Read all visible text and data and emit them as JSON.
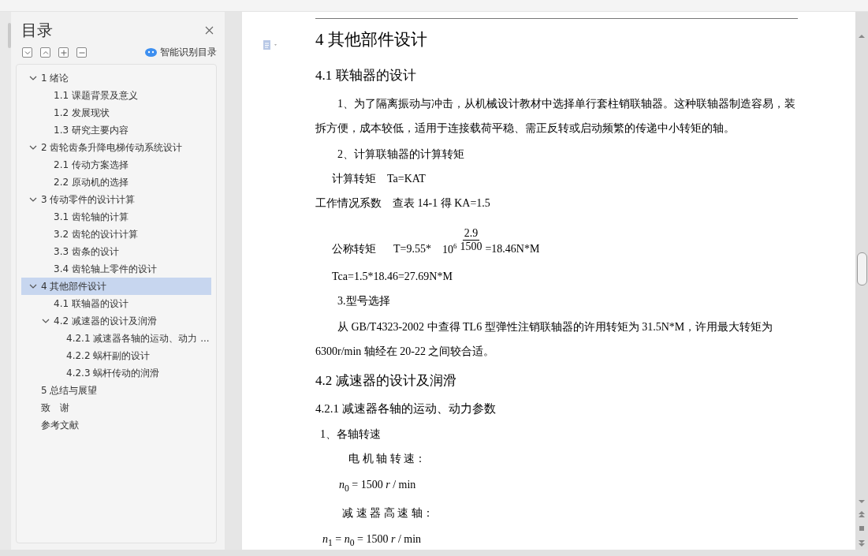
{
  "toc_panel": {
    "title": "目录",
    "smart_button": "智能识别目录",
    "items": [
      {
        "label": "1 绪论",
        "expanded": true,
        "selected": false,
        "children": [
          {
            "label": "1.1 课题背景及意义",
            "selected": false
          },
          {
            "label": "1.2 发展现状",
            "selected": false
          },
          {
            "label": "1.3 研究主要内容",
            "selected": false
          }
        ]
      },
      {
        "label": "2 齿轮齿条升降电梯传动系统设计",
        "expanded": true,
        "selected": false,
        "children": [
          {
            "label": "2.1 传动方案选择",
            "selected": false
          },
          {
            "label": "2.2 原动机的选择",
            "selected": false
          }
        ]
      },
      {
        "label": "3 传动零件的设计计算",
        "expanded": true,
        "selected": false,
        "children": [
          {
            "label": "3.1 齿轮轴的计算",
            "selected": false
          },
          {
            "label": "3.2 齿轮的设计计算",
            "selected": false
          },
          {
            "label": "3.3 齿条的设计",
            "selected": false
          },
          {
            "label": "3.4 齿轮轴上零件的设计",
            "selected": false
          }
        ]
      },
      {
        "label": "4 其他部件设计",
        "expanded": true,
        "selected": true,
        "children": [
          {
            "label": "4.1 联轴器的设计",
            "selected": false
          },
          {
            "label": "4.2 减速器的设计及润滑",
            "expanded": true,
            "selected": false,
            "children": [
              {
                "label": "4.2.1 减速器各轴的运动、动力 ...",
                "selected": false
              },
              {
                "label": "4.2.2 蜗杆副的设计",
                "selected": false
              },
              {
                "label": "4.2.3 蜗杆传动的润滑",
                "selected": false
              }
            ]
          }
        ]
      },
      {
        "label": "5 总结与展望",
        "selected": false
      },
      {
        "label": "致　谢",
        "selected": false
      },
      {
        "label": "参考文献",
        "selected": false
      }
    ]
  },
  "document": {
    "blocks": [
      {
        "kind": "h1",
        "text": "4 其他部件设计"
      },
      {
        "kind": "h2",
        "text": "4.1 联轴器的设计"
      },
      {
        "kind": "para",
        "text": "1、为了隔离振动与冲击，从机械设计教材中选择单行套柱销联轴器。这种联轴器制造容易，装拆方便，成本较低，适用于连接载荷平稳、需正反转或启动频繁的传递中小转矩的轴。"
      },
      {
        "kind": "line",
        "text": "2、计算联轴器的计算转矩"
      },
      {
        "kind": "pair",
        "label": "计算转矩",
        "value": "Ta=KAT"
      },
      {
        "kind": "pair",
        "label": "工作情况系数",
        "value": "查表 14-1 得 KA=1.5"
      },
      {
        "kind": "fraction",
        "label": "公称转矩",
        "prefix": "T=9.55*",
        "base": "10",
        "exponent": "6",
        "numerator": "2.9",
        "denominator": "1500",
        "suffix": "=18.46N*M"
      },
      {
        "kind": "line",
        "text": "Tca=1.5*18.46=27.69N*M"
      },
      {
        "kind": "line",
        "text": "3.型号选择"
      },
      {
        "kind": "para",
        "text": "从 GB/T4323-2002 中查得 TL6 型弹性注销联轴器的许用转矩为 31.5N*M，许用最大转矩为 6300r/min 轴经在 20-22 之间较合适。"
      },
      {
        "kind": "h2",
        "text": "4.2 减速器的设计及润滑"
      },
      {
        "kind": "h3",
        "text": "4.2.1 减速器各轴的运动、动力参数"
      },
      {
        "kind": "line",
        "text": "1、各轴转速"
      },
      {
        "kind": "line",
        "text": "电 机 轴 转 速："
      },
      {
        "kind": "math",
        "text": "*n*$_{0}$ = 1500 *r* / min"
      },
      {
        "kind": "line",
        "text": "减 速 器 高 速 轴："
      },
      {
        "kind": "math",
        "text": "*n*$_{1}$ = *n*$_{0}$ = 1500 *r* / min"
      }
    ]
  }
}
